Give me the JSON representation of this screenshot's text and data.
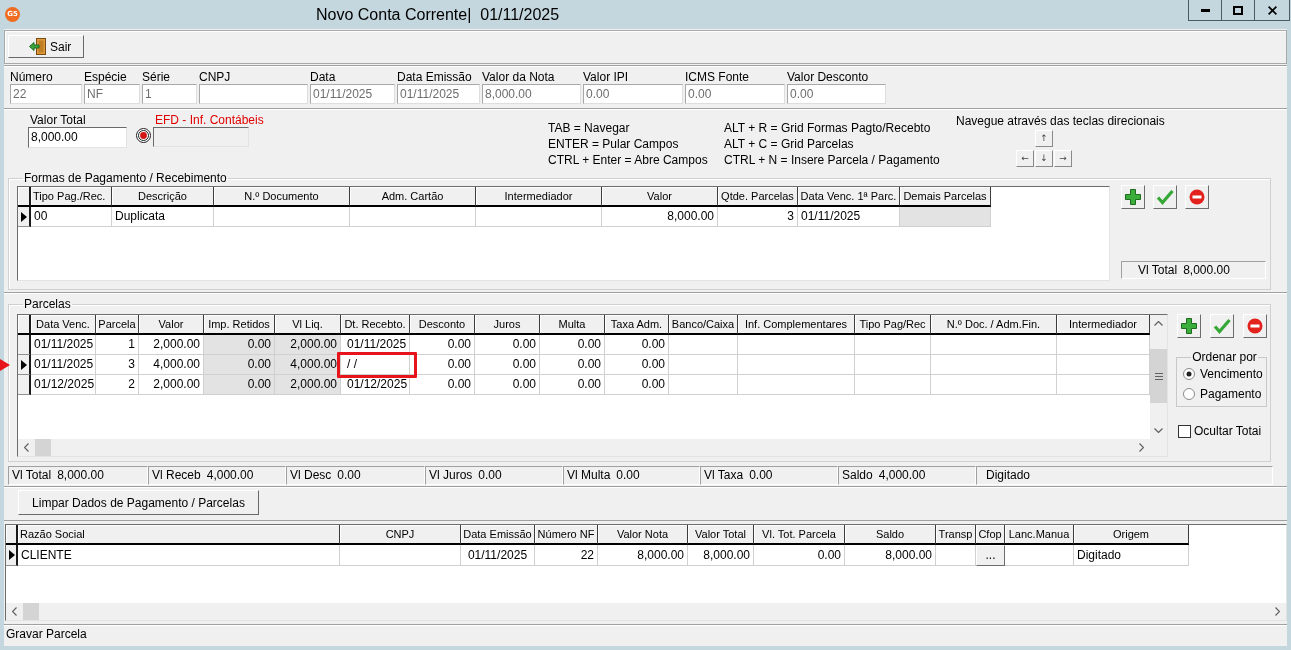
{
  "window": {
    "logo": "G5",
    "title": "Novo Conta Corrente|  01/11/2025"
  },
  "toolbar": {
    "buttons": [
      {
        "label": "Sair"
      }
    ]
  },
  "header_fields": [
    {
      "label": "Número",
      "value": "22",
      "disabled": true
    },
    {
      "label": "Espécie",
      "value": "NF",
      "disabled": true
    },
    {
      "label": "Série",
      "value": "1",
      "disabled": true
    },
    {
      "label": "CNPJ",
      "disabled": true
    },
    {
      "label": "Data",
      "value": "01/11/2025",
      "disabled": true
    },
    {
      "label": "Data Emissão",
      "value": "01/11/2025",
      "disabled": true
    },
    {
      "label": "Valor da Nota",
      "value": "8,000.00",
      "disabled": true
    },
    {
      "label": "Valor IPI",
      "value": "0.00",
      "disabled": true
    },
    {
      "label": "ICMS Fonte",
      "value": "0.00",
      "disabled": true
    },
    {
      "label": "Valor Desconto",
      "value": "0.00",
      "disabled": true
    }
  ],
  "info": {
    "valor_total": {
      "label": "Valor Total",
      "value": "8,000.00"
    },
    "efd": {
      "label": "EFD - Inf. Contábeis"
    },
    "shortcuts": [
      [
        "TAB = Navegar",
        "ENTER = Pular Campos",
        "CTRL + Enter = Abre Campos"
      ],
      [
        "ALT + R = Grid Formas Pagto/Recebto",
        "ALT + C = Grid Parcelas",
        "CTRL + N = Insere Parcela / Pagamento"
      ]
    ],
    "navigation": {
      "hint": "Navegue através das teclas direcionais",
      "keys": [
        "↑",
        "←",
        "↓",
        "→"
      ]
    }
  },
  "formas_pagamento": {
    "title": "Formas de Pagamento / Recebimento",
    "columns": [
      {
        "label": "Tipo Pag./Rec.",
        "readonly": false
      },
      {
        "label": "Descrição",
        "readonly": false
      },
      {
        "label": "N.º Documento",
        "readonly": false
      },
      {
        "label": "Adm. Cartão",
        "readonly": false
      },
      {
        "label": "Intermediador",
        "readonly": false
      },
      {
        "label": "Valor",
        "readonly": false
      },
      {
        "label": "Qtde. Parcelas",
        "readonly": false
      },
      {
        "label": "Data Venc. 1ª Parc.",
        "readonly": false
      },
      {
        "label": "Demais Parcelas",
        "readonly": true
      }
    ],
    "rows": [
      {
        "selected": true,
        "cells": [
          "00",
          "Duplicata",
          null,
          null,
          null,
          "8,000.00",
          "3",
          "01/11/2025",
          null
        ]
      }
    ],
    "total": {
      "label": "Vl Total",
      "value": "8,000.00"
    }
  },
  "parcelas": {
    "title": "Parcelas",
    "columns": [
      {
        "label": "Data Venc.",
        "readonly": false
      },
      {
        "label": "Parcela",
        "readonly": false
      },
      {
        "label": "Valor",
        "readonly": false
      },
      {
        "label": "Imp. Retidos",
        "readonly": true
      },
      {
        "label": "Vl Liq.",
        "readonly": true
      },
      {
        "label": "Dt. Recebto.",
        "readonly": false
      },
      {
        "label": "Desconto",
        "readonly": false
      },
      {
        "label": "Juros",
        "readonly": false
      },
      {
        "label": "Multa",
        "readonly": false
      },
      {
        "label": "Taxa Adm.",
        "readonly": false
      },
      {
        "label": "Banco/Caixa",
        "readonly": false
      },
      {
        "label": "Inf. Complementares",
        "readonly": false
      },
      {
        "label": "Tipo Pag/Rec",
        "readonly": false
      },
      {
        "label": "N.º Doc. / Adm.Fin.",
        "readonly": false
      },
      {
        "label": "Intermediador",
        "readonly": false
      }
    ],
    "rows": [
      {
        "selected": false,
        "flagged": false,
        "cells": [
          "01/11/2025",
          "1",
          "2,000.00",
          "0.00",
          "2,000.00",
          "01/11/2025",
          "0.00",
          "0.00",
          "0.00",
          "0.00",
          null,
          null,
          null,
          null,
          null
        ]
      },
      {
        "selected": true,
        "flagged": true,
        "cells": [
          "01/11/2025",
          "3",
          "4,000.00",
          "0.00",
          "4,000.00",
          "/ /",
          "0.00",
          "0.00",
          "0.00",
          "0.00",
          null,
          null,
          null,
          null,
          null
        ]
      },
      {
        "selected": false,
        "flagged": false,
        "cells": [
          "01/12/2025",
          "2",
          "2,000.00",
          "0.00",
          "2,000.00",
          "01/12/2025",
          "0.00",
          "0.00",
          "0.00",
          "0.00",
          null,
          null,
          null,
          null,
          null
        ]
      }
    ],
    "sort": {
      "title": "Ordenar por",
      "options": [
        {
          "label": "Vencimento",
          "selected": true
        },
        {
          "label": "Pagamento",
          "selected": false
        }
      ]
    },
    "hide_totals": {
      "label": "Ocultar Totai",
      "checked": false
    }
  },
  "totals": [
    {
      "label": "Vl Total",
      "value": "8,000.00"
    },
    {
      "label": "Vl Receb",
      "value": "4,000.00"
    },
    {
      "label": "Vl Desc",
      "value": "0.00"
    },
    {
      "label": "Vl Juros",
      "value": "0.00"
    },
    {
      "label": "Vl Multa",
      "value": "0.00"
    },
    {
      "label": "Vl Taxa",
      "value": "0.00"
    },
    {
      "label": "Saldo",
      "value": "4,000.00"
    },
    {
      "label": "Digitado"
    }
  ],
  "clear_button": {
    "label": "Limpar Dados de Pagamento / Parcelas"
  },
  "documentos": {
    "columns": [
      {
        "label": "Razão Social",
        "kind": "text"
      },
      {
        "label": "CNPJ",
        "kind": "text"
      },
      {
        "label": "Data Emissão",
        "kind": "text"
      },
      {
        "label": "Número NF",
        "kind": "text"
      },
      {
        "label": "Valor Nota",
        "kind": "text"
      },
      {
        "label": "Valor Total",
        "kind": "text"
      },
      {
        "label": "Vl. Tot. Parcela",
        "kind": "text"
      },
      {
        "label": "Saldo",
        "kind": "text"
      },
      {
        "label": "Transp",
        "kind": "text"
      },
      {
        "label": "Cfop",
        "kind": "button"
      },
      {
        "label": "Lanc.Manua",
        "kind": "text"
      },
      {
        "label": "Origem",
        "kind": "text"
      }
    ],
    "rows": [
      {
        "selected": true,
        "cells": [
          "CLIENTE",
          null,
          "01/11/2025",
          "22",
          "8,000.00",
          "8,000.00",
          "0.00",
          "8,000.00",
          null,
          "...",
          null,
          "Digitado"
        ]
      }
    ]
  },
  "status_bar": {
    "text": "Gravar Parcela"
  }
}
